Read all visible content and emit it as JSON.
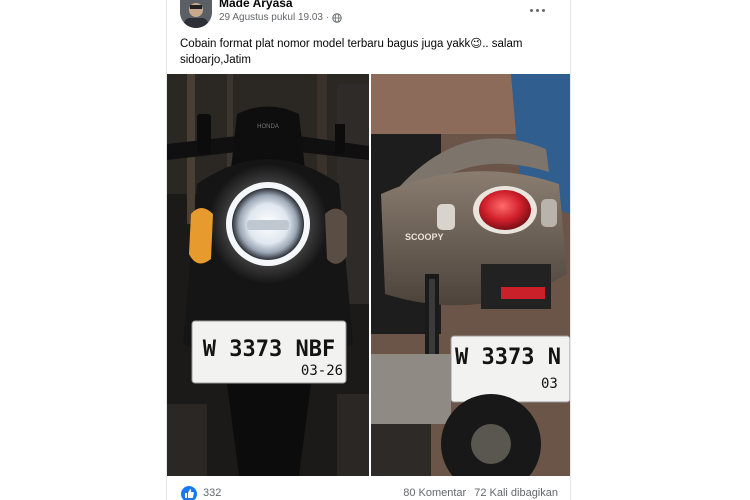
{
  "post": {
    "author": "Made Aryasa",
    "timestamp": "29 Agustus pukul 19.03",
    "privacy_icon": "globe-icon",
    "caption": "Cobain format plat nomor model terbaru bagus juga yakk😉.. salam sidoarjo,Jatim",
    "more_icon": "more-options-icon"
  },
  "photos": {
    "left": {
      "headlight_brand": "HONDA",
      "plate_number": "W 3373 NBF",
      "plate_expiry": "03-26"
    },
    "right": {
      "body_badge": "SCOOPY",
      "plate_number": "W 3373 N",
      "plate_expiry": "03"
    }
  },
  "footer": {
    "like_icon": "thumbs-up-icon",
    "like_count": "332",
    "comments": "80 Komentar",
    "shares": "72 Kali dibagikan"
  },
  "colors": {
    "like_blue": "#1877f2",
    "meta_gray": "#65676b",
    "text": "#050505"
  }
}
